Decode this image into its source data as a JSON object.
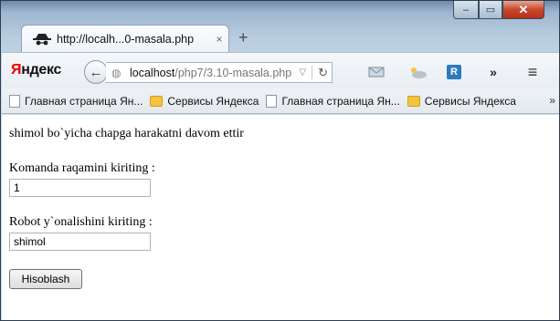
{
  "window": {
    "controls": [
      "–",
      "▭",
      "✕"
    ]
  },
  "tab": {
    "title": "http://localh...0-masala.php",
    "close": "×",
    "new_tab": "+"
  },
  "navbar": {
    "logo": "Яндекс",
    "url_host": "localhost",
    "url_path": "/php7/3.10-masala.php"
  },
  "bookmarks": [
    {
      "label": "Главная страница Ян...",
      "type": "page"
    },
    {
      "label": "Сервисы Яндекса",
      "type": "folder"
    },
    {
      "label": "Главная страница Ян...",
      "type": "page"
    },
    {
      "label": "Сервисы Яндекса",
      "type": "folder"
    }
  ],
  "content": {
    "message": "shimol bo`yicha chapga harakatni davom ettir",
    "label1": "Komanda raqamini kiriting :",
    "field1_value": "1",
    "label2": "Robot y`onalishini kiriting :",
    "field2_value": "shimol",
    "button": "Hisoblash"
  }
}
